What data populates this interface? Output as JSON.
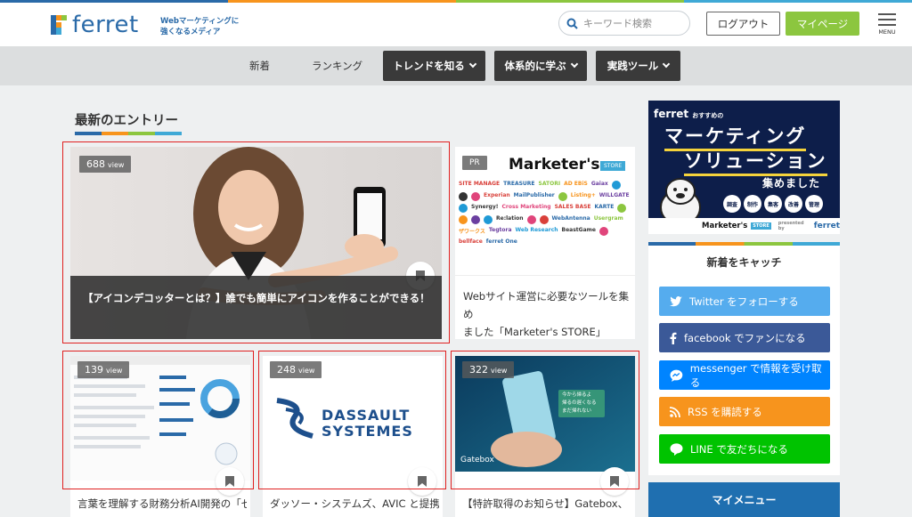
{
  "brand": {
    "name": "ferret",
    "tagline_line1": "Webマーケティングに",
    "tagline_line2": "強くなるメディア",
    "accent": "#2a6aa8"
  },
  "header": {
    "search_placeholder": "キーワード検索",
    "logout_label": "ログアウト",
    "mypage_label": "マイページ",
    "menu_label": "MENU"
  },
  "nav": {
    "items": [
      {
        "label": "新着"
      },
      {
        "label": "ランキング"
      },
      {
        "label": "トレンドを知る"
      },
      {
        "label": "体系的に学ぶ"
      },
      {
        "label": "実践ツール"
      }
    ]
  },
  "main": {
    "section_title": "最新のエントリー",
    "hero": {
      "views": "688",
      "view_unit": "view",
      "title": "【アイコンデコッターとは？】誰でも簡単にアイコンを作ることができる！"
    },
    "pr_card": {
      "badge": "PR",
      "banner_title": "Marketer's",
      "banner_store": "STORE",
      "logos": [
        "SITE MANAGE",
        "TREASURE",
        "SATORI",
        "AD EBiS",
        "Gaiax",
        "",
        "",
        "",
        "Experian",
        "MailPublisher",
        "",
        "Listing+",
        "WILLGATE",
        "",
        "Synergy!",
        "Cross Marketing",
        "SALES BASE",
        "KARTE",
        "",
        "",
        "",
        "",
        "Re:lation",
        "",
        "",
        "WebAntenna",
        "Usergram",
        "ザワークス",
        "Tegtora",
        "Web Research",
        "BeastGame",
        "",
        "bellface",
        "ferret One"
      ],
      "title_line1": "Webサイト運営に必要なツールを集め",
      "title_line2": "ました「Marketer's STORE」"
    },
    "cards": [
      {
        "views": "139",
        "view_unit": "view",
        "title": "言葉を理解する財務分析AI開発の「ゼ"
      },
      {
        "views": "248",
        "view_unit": "view",
        "logo_line1": "DASSAULT",
        "logo_line2": "SYSTEMES",
        "title": "ダッソー・システムズ、AVIC と提携"
      },
      {
        "views": "322",
        "view_unit": "view",
        "bubble_line1": "今から帰るよ",
        "bubble_line2": "帰るの遅くなる",
        "bubble_line3": "まだ帰れない",
        "brand_label": "Gatebox",
        "title": "【特許取得のお知らせ】Gatebox、"
      }
    ]
  },
  "sidebar": {
    "banner": {
      "brand": "ferret",
      "brand_suffix": "おすすめの",
      "line1": "マーケティング",
      "line2": "ソリューション",
      "line3": "集めました",
      "chips": [
        "調査",
        "制作",
        "集客",
        "改善",
        "管理"
      ],
      "footer": "Marketer's",
      "footer_store": "STORE",
      "presented": "presented by",
      "presented_brand": "ferret"
    },
    "follow": {
      "heading": "新着をキャッチ",
      "buttons": [
        {
          "label": "Twitter をフォローする",
          "color": "#55acee"
        },
        {
          "label": "facebook でファンになる",
          "color": "#3b5998"
        },
        {
          "label": "messenger で情報を受け取る",
          "color": "#0084ff"
        },
        {
          "label": "RSS を購読する",
          "color": "#f7941d"
        },
        {
          "label": "LINE で友だちになる",
          "color": "#00c300"
        }
      ]
    },
    "mymenu_label": "マイメニュー"
  },
  "colors": {
    "strip": [
      "#2a6aa8",
      "#f7941d",
      "#8cc63f",
      "#3fa9d6"
    ],
    "highlight": "#e02020"
  }
}
